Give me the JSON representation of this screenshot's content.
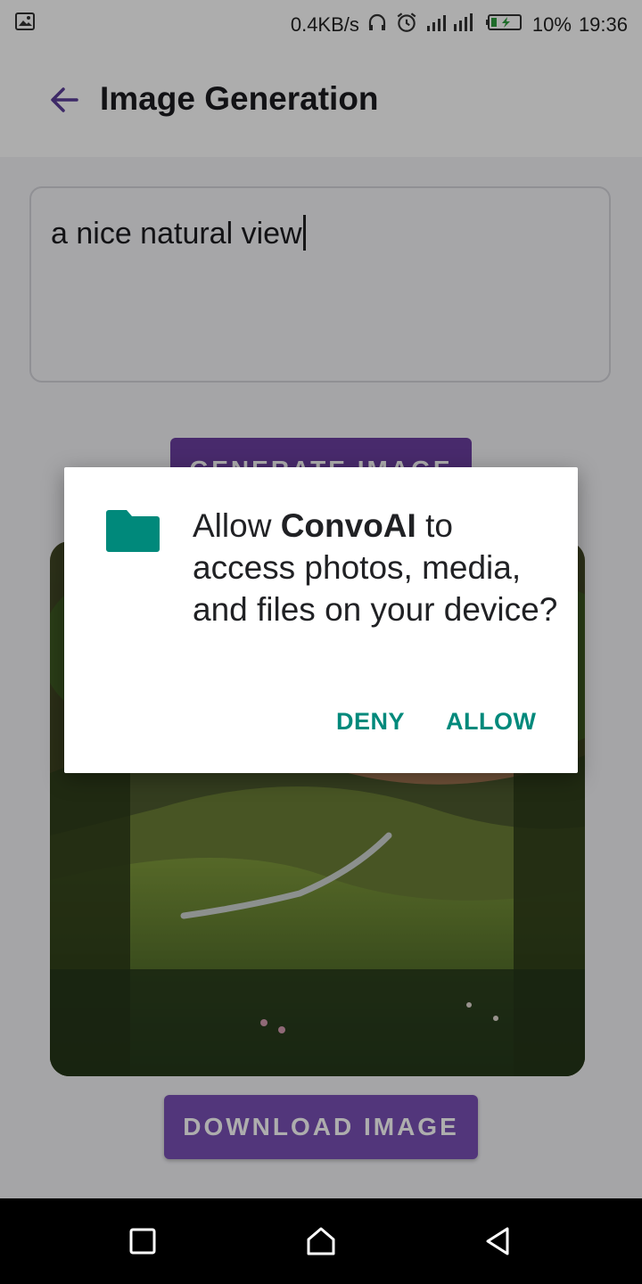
{
  "status_bar": {
    "net_speed": "0.4KB/s",
    "battery": "10%",
    "time": "19:36"
  },
  "app_bar": {
    "title": "Image Generation"
  },
  "prompt": {
    "value": "a nice natural view"
  },
  "buttons": {
    "generate_label": "GENERATE IMAGE",
    "download_label": "DOWNLOAD IMAGE"
  },
  "dialog": {
    "text_before": "Allow ",
    "app_name": "ConvoAI",
    "text_after": " to access photos, media, and files on your device?",
    "deny_label": "DENY",
    "allow_label": "ALLOW",
    "icon": "folder-icon",
    "accent_color": "#00897b"
  },
  "colors": {
    "button_purple": "#6b3fa0",
    "dialog_accent": "#00897b"
  }
}
